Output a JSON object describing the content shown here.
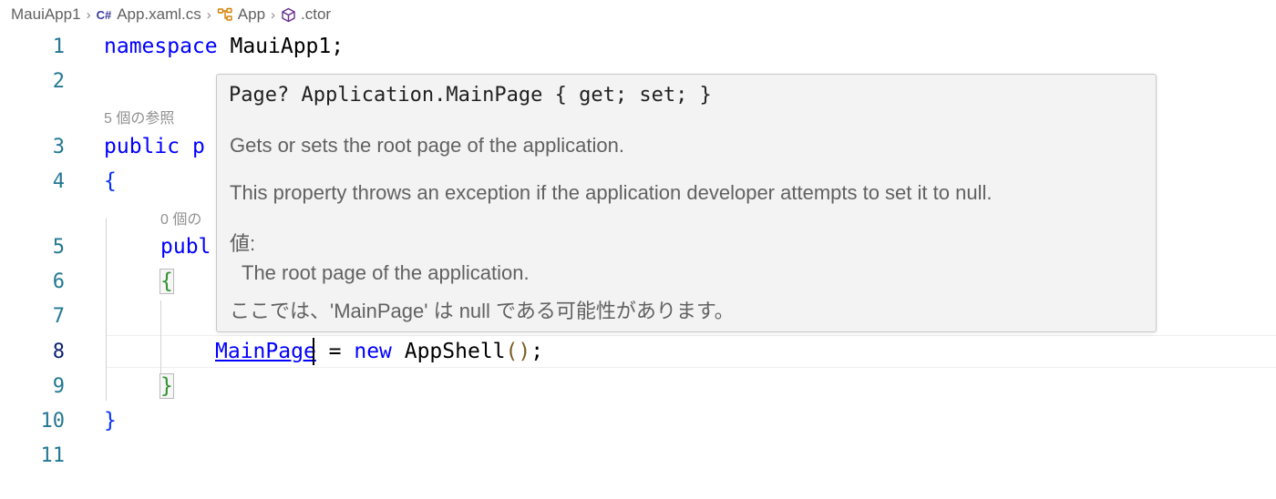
{
  "breadcrumb": {
    "project": "MauiApp1",
    "file_badge": "C#",
    "file": "App.xaml.cs",
    "class_name": "App",
    "member": ".ctor",
    "separator": "›"
  },
  "editor": {
    "line_numbers": [
      "1",
      "2",
      "3",
      "4",
      "5",
      "6",
      "7",
      "8",
      "9",
      "10",
      "11"
    ],
    "active_line": "8",
    "codelens": {
      "class_refs": "5 個の参照",
      "ctor_refs_visible": "0 個の"
    },
    "lines": {
      "l1_kw": "namespace",
      "l1_rest": " MauiApp1;",
      "l3_kw": "public",
      "l3_rest": " p",
      "l4": "{",
      "l5": "publ",
      "l6": "{",
      "l8_link_a": "MainPag",
      "l8_link_b": "e",
      "l8_eq": " = ",
      "l8_new": "new",
      "l8_type": " AppShell",
      "l8_parens": "()",
      "l8_semi": ";",
      "l9": "}",
      "l10": "}"
    }
  },
  "hover": {
    "signature": "Page? Application.MainPage { get; set; }",
    "summary": "Gets or sets the root page of the application.",
    "remarks": "This property throws an exception if the application developer attempts to set it to null.",
    "value_label": "値:",
    "value_text": "The root page of the application.",
    "null_note": "ここでは、'MainPage' は null である可能性があります。"
  },
  "colors": {
    "keyword": "#0000ff",
    "line_number": "#237893",
    "hover_bg": "#f3f3f3",
    "brace_green": "#319331"
  }
}
